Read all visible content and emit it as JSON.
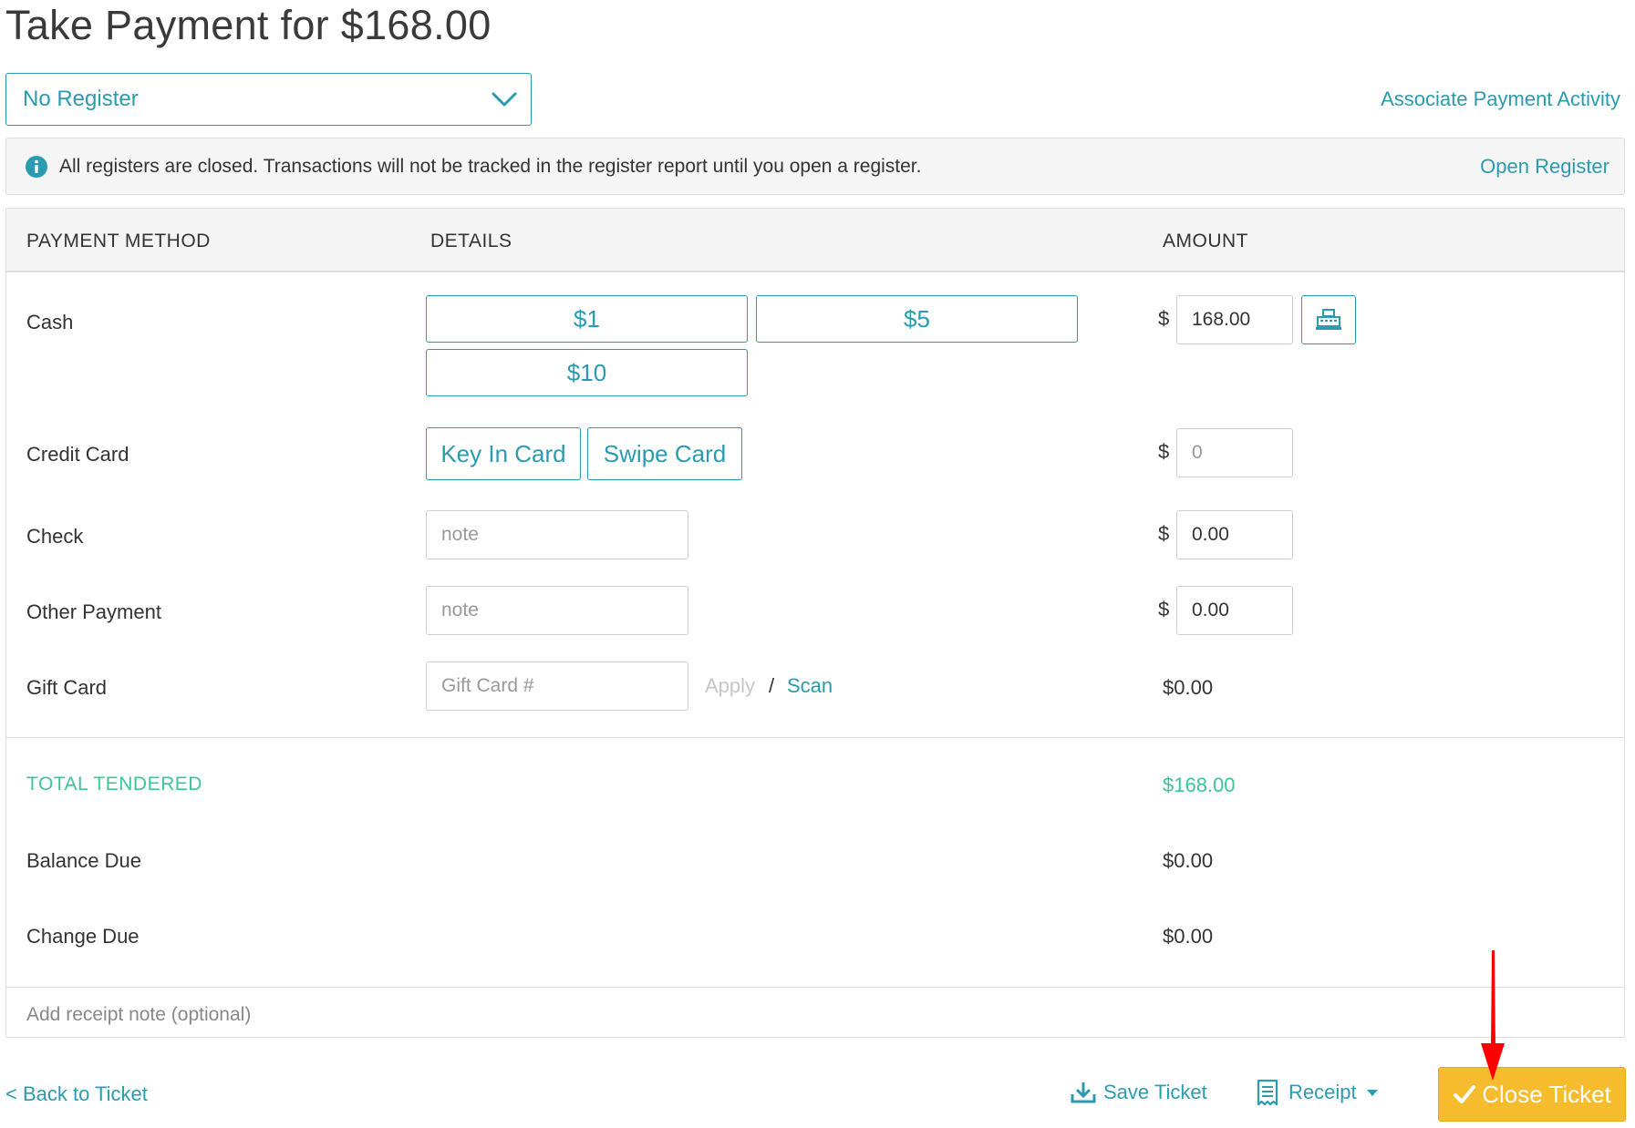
{
  "page": {
    "title": "Take Payment for $168.00"
  },
  "register": {
    "selected": "No Register",
    "associate_link": "Associate Payment Activity"
  },
  "alert": {
    "message": "All registers are closed. Transactions will not be tracked in the register report until you open a register.",
    "action": "Open Register"
  },
  "table": {
    "headers": {
      "method": "PAYMENT METHOD",
      "details": "DETAILS",
      "amount": "AMOUNT"
    },
    "currency_symbol": "$",
    "cash": {
      "label": "Cash",
      "quick_buttons": [
        "$1",
        "$5",
        "$10"
      ],
      "amount": "168.00"
    },
    "credit_card": {
      "label": "Credit Card",
      "key_in": "Key In Card",
      "swipe": "Swipe Card",
      "amount_placeholder": "0"
    },
    "check": {
      "label": "Check",
      "note_placeholder": "note",
      "amount": "0.00"
    },
    "other": {
      "label": "Other Payment",
      "note_placeholder": "note",
      "amount": "0.00"
    },
    "gift_card": {
      "label": "Gift Card",
      "placeholder": "Gift Card #",
      "apply": "Apply",
      "separator": "/",
      "scan": "Scan",
      "amount": "$0.00"
    }
  },
  "totals": {
    "tendered_label": "TOTAL TENDERED",
    "tendered": "$168.00",
    "balance_label": "Balance Due",
    "balance": "$0.00",
    "change_label": "Change Due",
    "change": "$0.00"
  },
  "receipt_note_placeholder": "Add receipt note (optional)",
  "footer": {
    "back": "< Back to Ticket",
    "save": "Save Ticket",
    "receipt": "Receipt",
    "close": "Close Ticket"
  },
  "colors": {
    "accent": "#2a9bb0",
    "success": "#3cc49a",
    "primary_button": "#f7bb2e",
    "annotation_arrow": "#ff0000"
  }
}
